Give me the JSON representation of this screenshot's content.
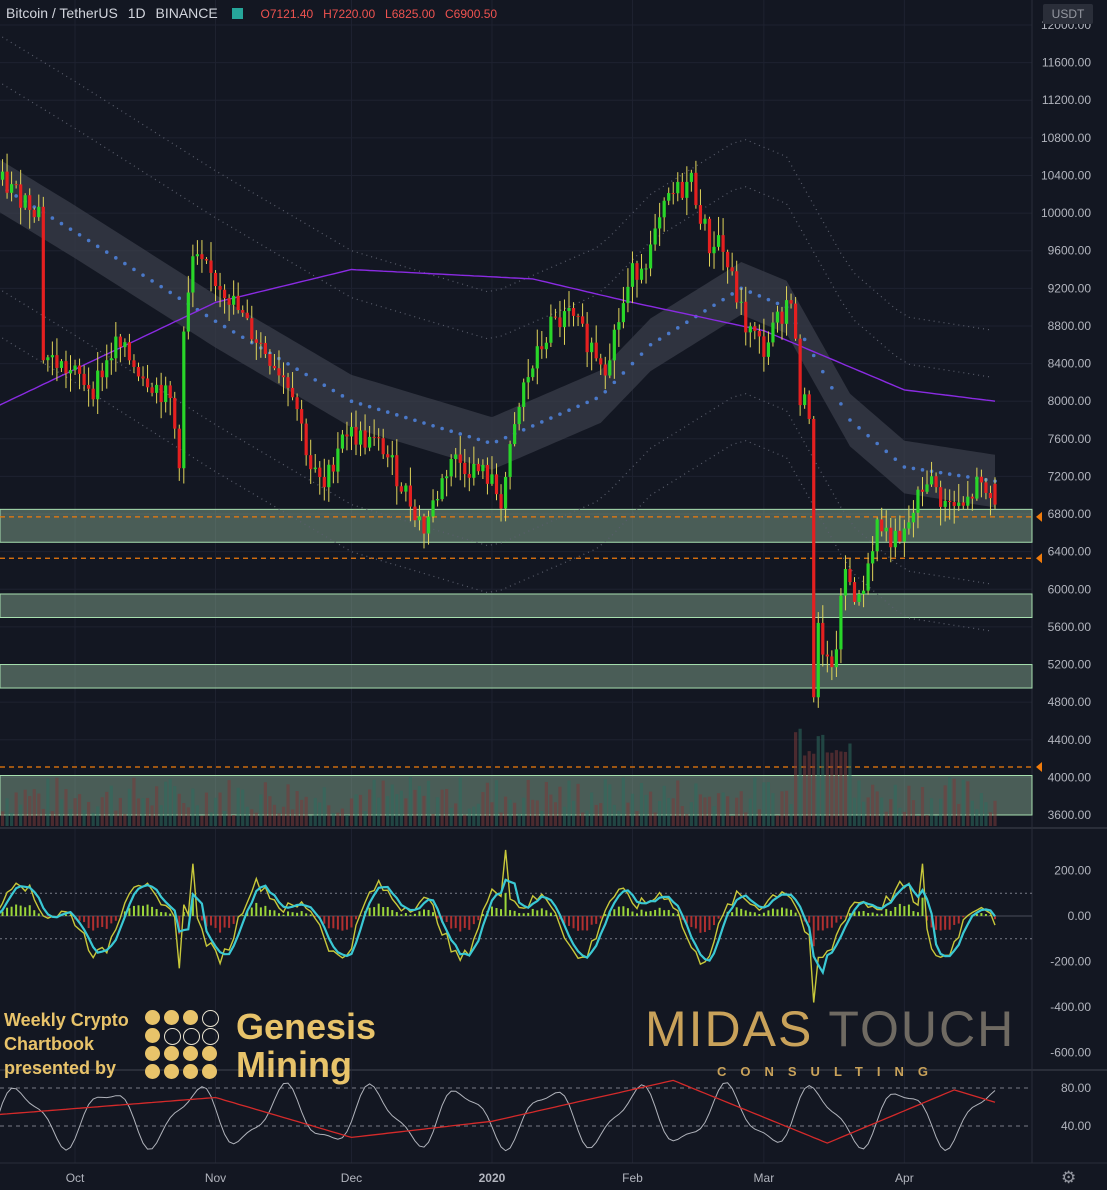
{
  "header": {
    "symbol": "Bitcoin / TetherUS",
    "interval": "1D",
    "exchange": "BINANCE",
    "open": "O7121.40",
    "high": "H7220.00",
    "low": "L6825.00",
    "close": "C6900.50",
    "currency_badge": "USDT"
  },
  "watermark": {
    "left_lines": [
      "Weekly Crypto",
      "Chartbook",
      "presented by"
    ],
    "genesis_lines": [
      "Genesis",
      "Mining"
    ],
    "midas_main": "MIDAS",
    "midas_touch": "TOUCH",
    "consulting": "CONSULTING"
  },
  "colors": {
    "background": "#131722",
    "up": "#29d629",
    "down": "#e52020",
    "zone": "#8fb39a",
    "dashed": "#f07b0b",
    "ma_long": "#8a2be2",
    "ma_mid": "#4a78c8",
    "gold": "#e8c36a"
  },
  "chart_data": [
    {
      "type": "candlestick",
      "ylim": [
        3600,
        12000
      ],
      "yticks": [
        "12000.00",
        "11600.00",
        "11200.00",
        "10800.00",
        "10400.00",
        "10000.00",
        "9600.00",
        "9200.00",
        "8800.00",
        "8400.00",
        "8000.00",
        "7600.00",
        "7200.00",
        "6800.00",
        "6400.00",
        "6000.00",
        "5600.00",
        "5200.00",
        "4800.00",
        "4400.00",
        "4000.00",
        "3600.00"
      ],
      "ytick_values": [
        12000,
        11600,
        11200,
        10800,
        10400,
        10000,
        9600,
        9200,
        8800,
        8400,
        8000,
        7600,
        7200,
        6800,
        6400,
        6000,
        5600,
        5200,
        4800,
        4400,
        4000,
        3600
      ],
      "x_range": [
        "2019-09-14",
        "2020-04-21"
      ],
      "xticks": [
        {
          "label": "Oct",
          "date": "2019-10-01"
        },
        {
          "label": "Nov",
          "date": "2019-11-01"
        },
        {
          "label": "Dec",
          "date": "2019-12-01"
        },
        {
          "label": "2020",
          "date": "2020-01-01"
        },
        {
          "label": "Feb",
          "date": "2020-02-01"
        },
        {
          "label": "Mar",
          "date": "2020-03-01"
        },
        {
          "label": "Apr",
          "date": "2020-04-01"
        }
      ],
      "ohlc_keypoints": [
        [
          "2019-09-14",
          10350
        ],
        [
          "2019-09-23",
          10050
        ],
        [
          "2019-09-24",
          8500
        ],
        [
          "2019-10-05",
          8150
        ],
        [
          "2019-10-10",
          8600
        ],
        [
          "2019-10-22",
          8000
        ],
        [
          "2019-10-24",
          7400
        ],
        [
          "2019-10-25",
          8700
        ],
        [
          "2019-10-27",
          9500
        ],
        [
          "2019-11-03",
          9200
        ],
        [
          "2019-11-08",
          8800
        ],
        [
          "2019-11-18",
          8150
        ],
        [
          "2019-11-22",
          7300
        ],
        [
          "2019-11-25",
          7050
        ],
        [
          "2019-11-29",
          7700
        ],
        [
          "2019-12-08",
          7500
        ],
        [
          "2019-12-17",
          6650
        ],
        [
          "2019-12-23",
          7400
        ],
        [
          "2019-12-31",
          7200
        ],
        [
          "2020-01-03",
          6950
        ],
        [
          "2020-01-08",
          8150
        ],
        [
          "2020-01-14",
          8800
        ],
        [
          "2020-01-18",
          8900
        ],
        [
          "2020-01-26",
          8400
        ],
        [
          "2020-02-01",
          9350
        ],
        [
          "2020-02-05",
          9600
        ],
        [
          "2020-02-09",
          10150
        ],
        [
          "2020-02-14",
          10350
        ],
        [
          "2020-02-18",
          9650
        ],
        [
          "2020-02-20",
          9750
        ],
        [
          "2020-02-26",
          8800
        ],
        [
          "2020-03-01",
          8550
        ],
        [
          "2020-03-07",
          9150
        ],
        [
          "2020-03-09",
          8000
        ],
        [
          "2020-03-11",
          7900
        ],
        [
          "2020-03-12",
          4900
        ],
        [
          "2020-03-13",
          5550
        ],
        [
          "2020-03-16",
          5050
        ],
        [
          "2020-03-19",
          6200
        ],
        [
          "2020-03-22",
          5850
        ],
        [
          "2020-03-26",
          6700
        ],
        [
          "2020-03-31",
          6450
        ],
        [
          "2020-04-06",
          7200
        ],
        [
          "2020-04-10",
          6900
        ],
        [
          "2020-04-14",
          6850
        ],
        [
          "2020-04-17",
          7100
        ],
        [
          "2020-04-21",
          6900
        ]
      ],
      "last_candle": {
        "open": 7121.4,
        "high": 7220.0,
        "low": 6825.0,
        "close": 6900.5
      },
      "support_zones": [
        [
          6500,
          6850
        ],
        [
          5700,
          5950
        ],
        [
          4950,
          5200
        ],
        [
          3600,
          4020
        ]
      ],
      "dashed_levels": [
        6770,
        6330,
        4110
      ],
      "moving_average_long": [
        [
          "2019-09-14",
          7950
        ],
        [
          "2019-11-01",
          9050
        ],
        [
          "2019-12-01",
          9400
        ],
        [
          "2020-01-10",
          9300
        ],
        [
          "2020-02-01",
          9050
        ],
        [
          "2020-03-01",
          8750
        ],
        [
          "2020-04-01",
          8120
        ],
        [
          "2020-04-21",
          8000
        ]
      ],
      "ema_band_center": [
        [
          "2019-09-14",
          10300
        ],
        [
          "2019-10-01",
          9800
        ],
        [
          "2019-11-01",
          8850
        ],
        [
          "2019-12-01",
          8000
        ],
        [
          "2020-01-01",
          7550
        ],
        [
          "2020-01-25",
          8050
        ],
        [
          "2020-02-05",
          8600
        ],
        [
          "2020-02-25",
          9200
        ],
        [
          "2020-03-06",
          9000
        ],
        [
          "2020-03-20",
          7800
        ],
        [
          "2020-04-01",
          7300
        ],
        [
          "2020-04-21",
          7150
        ]
      ]
    },
    {
      "type": "line",
      "ylim": [
        -650,
        300
      ],
      "yticks": [
        "200.00",
        "0.00",
        "-200.00",
        "-400.00",
        "-600.00"
      ],
      "ytick_values": [
        200,
        0,
        -200,
        -400,
        -600
      ],
      "oscillator_extremes": [
        [
          "2019-10-27",
          230
        ],
        [
          "2019-10-24",
          -230
        ],
        [
          "2020-01-04",
          290
        ],
        [
          "2020-03-12",
          -380
        ],
        [
          "2020-04-05",
          230
        ],
        [
          "2020-04-21",
          -40
        ]
      ]
    },
    {
      "type": "line",
      "ylim": [
        15,
        95
      ],
      "yticks": [
        "80.00",
        "40.00"
      ],
      "ytick_values": [
        80,
        40
      ],
      "rsi_slow": [
        [
          "2019-09-14",
          52
        ],
        [
          "2019-11-01",
          70
        ],
        [
          "2019-12-01",
          28
        ],
        [
          "2020-01-01",
          45
        ],
        [
          "2020-02-10",
          88
        ],
        [
          "2020-03-15",
          22
        ],
        [
          "2020-04-12",
          78
        ],
        [
          "2020-04-21",
          65
        ]
      ]
    }
  ]
}
